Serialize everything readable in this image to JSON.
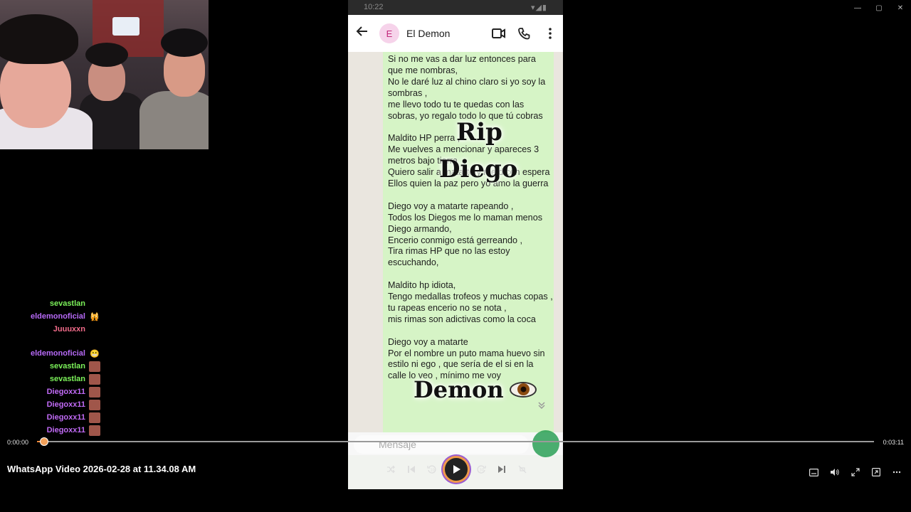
{
  "window": {
    "minimize_label": "—",
    "maximize_label": "▢",
    "close_label": "✕"
  },
  "chat": {
    "messages": [
      {
        "user": "sevastlan",
        "color": "#7cf25a",
        "emote": ""
      },
      {
        "user": "eldemonoficial",
        "color": "#b76af7",
        "emote": "🙀"
      },
      {
        "user": "Juuuxxn",
        "color": "#f36c8b",
        "emote": ""
      },
      {
        "user": "eldemonoficial",
        "color": "#b76af7",
        "emote": "😬"
      },
      {
        "user": "sevastlan",
        "color": "#7cf25a",
        "emote": ""
      },
      {
        "user": "sevastlan",
        "color": "#7cf25a",
        "emote": ""
      },
      {
        "user": "Diegoxx11",
        "color": "#c06af5",
        "emote": ""
      },
      {
        "user": "Diegoxx11",
        "color": "#c06af5",
        "emote": ""
      },
      {
        "user": "Diegoxx11",
        "color": "#c06af5",
        "emote": ""
      },
      {
        "user": "Diegoxx11",
        "color": "#c06af5",
        "emote": ""
      }
    ]
  },
  "phone": {
    "status_time": "10:22",
    "status_icons": "▾◢▮",
    "contact_initial": "E",
    "contact_name": "El Demon",
    "message": "Si no me vas a dar luz entonces para que me nombras,\nNo le daré luz al chino claro si yo soy la sombras ,\n me llevo todo tu te quedas con las sobras,  yo regalo todo lo que tú cobras\n\nMaldito HP perra ,\nMe vuelves a mencionar y apareces 3 metros bajo tierra\nQuiero salir a matarte y me dicen espera\nEllos quien la paz pero yo amo la guerra\n\nDiego voy a matarte rapeando ,\nTodos los Diegos me lo maman menos Diego armando,\nEncerio conmigo está gerreando ,\nTira rimas HP que no las estoy escuchando,\n\nMaldito hp idiota,\nTengo medallas trofeos y muchas copas , tu rapeas encerio no se nota ,\nmis rimas son adictivas como la coca\n\nDiego voy a matarte\nPor el nombre un puto mama huevo sin estilo ni ego , que sería de el si en la calle lo veo , mínimo me voy",
    "overlay_rip": "Rip",
    "overlay_diego": "Diego",
    "overlay_demon": "Demon",
    "input_placeholder": "Mensaje"
  },
  "player": {
    "current_time": "0:00:00",
    "total_time": "0:03:11",
    "progress": 0.0,
    "title": "WhatsApp Video 2026-02-28 at 11.34.08 AM",
    "accent": "#f08a3a"
  }
}
